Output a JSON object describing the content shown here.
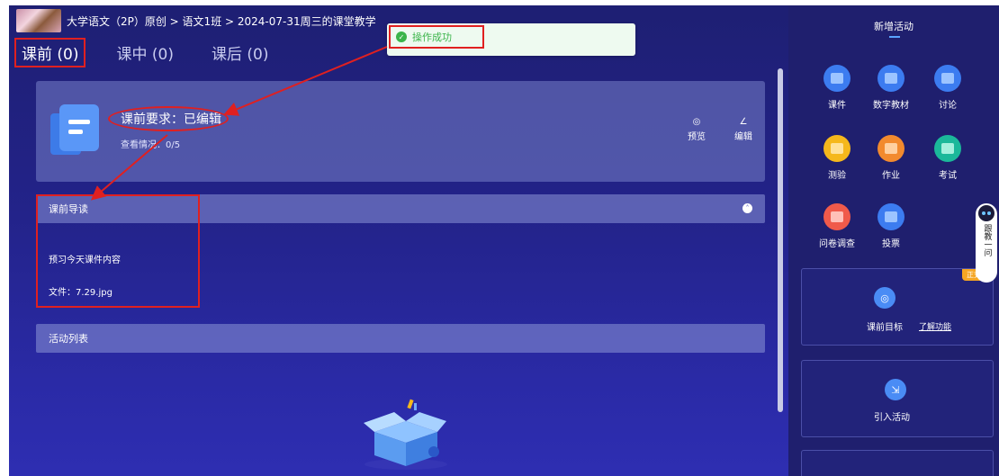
{
  "breadcrumb": "大学语文（2P）原创 > 语文1班 > 2024-07-31周三的课堂教学",
  "tabs": [
    {
      "label": "课前 (0)",
      "active": true
    },
    {
      "label": "课中 (0)",
      "active": false
    },
    {
      "label": "课后 (0)",
      "active": false
    }
  ],
  "toast": {
    "text": "操作成功"
  },
  "requirement_card": {
    "title": "课前要求：已编辑",
    "view_stats": "查看情况：0/5",
    "preview_label": "预览",
    "edit_label": "编辑"
  },
  "guide": {
    "header": "课前导读",
    "content": "预习今天课件内容",
    "file": "文件：7.29.jpg"
  },
  "activity_list": {
    "header": "活动列表"
  },
  "sidebar": {
    "title": "新增活动",
    "activities": [
      {
        "label": "课件",
        "color": "#3c7cf0",
        "icon": "courseware-icon"
      },
      {
        "label": "数字教材",
        "color": "#3c7cf0",
        "icon": "digital-textbook-icon"
      },
      {
        "label": "讨论",
        "color": "#3c7cf0",
        "icon": "discussion-icon"
      },
      {
        "label": "测验",
        "color": "#f5b81c",
        "icon": "quiz-icon"
      },
      {
        "label": "作业",
        "color": "#f28a2e",
        "icon": "homework-icon"
      },
      {
        "label": "考试",
        "color": "#1bb89a",
        "icon": "exam-icon"
      },
      {
        "label": "问卷调查",
        "color": "#f05a4a",
        "icon": "survey-icon"
      },
      {
        "label": "投票",
        "color": "#3c7cf0",
        "icon": "vote-icon"
      }
    ],
    "goal_card": {
      "label": "课前目标",
      "link": "了解功能",
      "badge": "正式版"
    },
    "import_card": {
      "label": "引入活动"
    }
  },
  "floating_helper": {
    "text": "跟教一问"
  }
}
